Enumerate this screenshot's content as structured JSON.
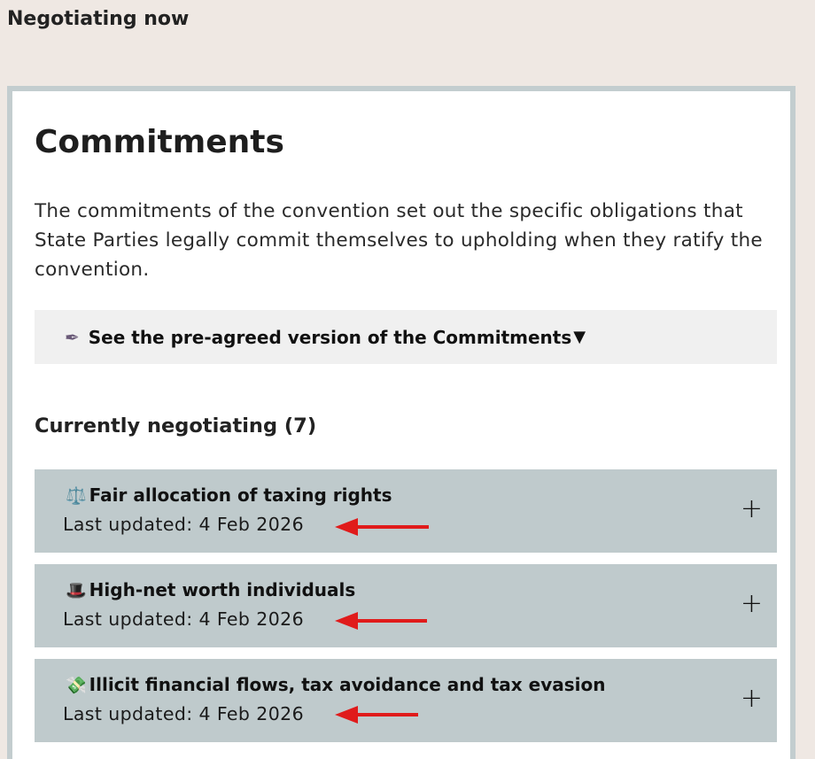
{
  "page": {
    "top_heading": "Negotiating now"
  },
  "panel": {
    "title": "Commitments",
    "description": "The commitments of the convention set out the specific obligations that State Parties legally commit themselves to upholding when they ratify the convention.",
    "details": {
      "icon": "✒",
      "icon_name": "fountain-pen-icon",
      "label": "See the pre-agreed version of the Commitments",
      "toggle": "▼"
    },
    "section_heading": "Currently negotiating (7)",
    "items": [
      {
        "icon": "⚖️",
        "icon_name": "balance-scale-icon",
        "title": "Fair allocation of taxing rights",
        "updated": "Last updated: 4 Feb 2026",
        "expand": "+"
      },
      {
        "icon": "🎩",
        "icon_name": "top-hat-icon",
        "title": "High-net worth individuals",
        "updated": "Last updated: 4 Feb 2026",
        "expand": "+"
      },
      {
        "icon": "💸",
        "icon_name": "money-with-wings-icon",
        "title": "Illicit financial flows, tax avoidance and tax evasion",
        "updated": "Last updated: 4 Feb 2026",
        "expand": "+"
      }
    ]
  },
  "colors": {
    "page_background": "#efe8e3",
    "panel_border": "#c3cdcf",
    "card_background": "#bfcacc",
    "details_background": "#f0f0f0",
    "annotation_arrow": "#e01b1b"
  }
}
